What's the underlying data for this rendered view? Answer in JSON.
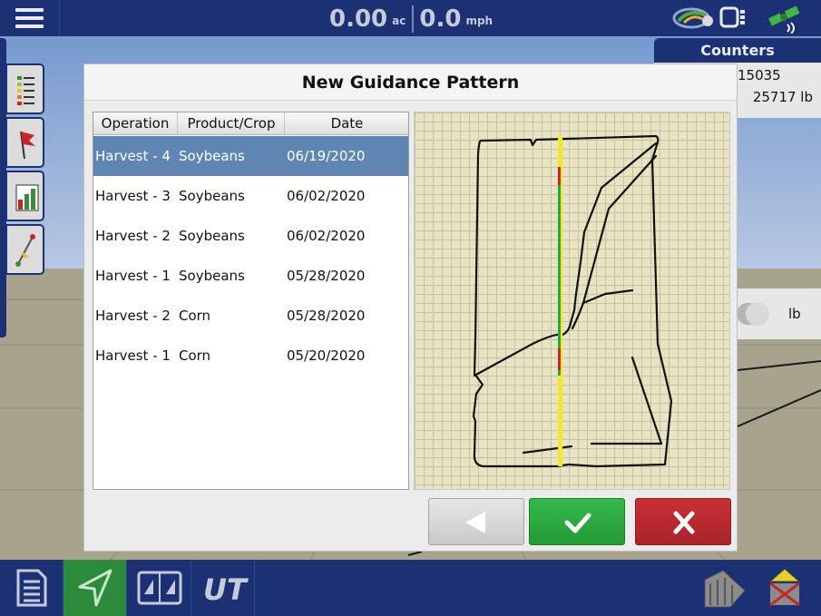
{
  "top_bar": {
    "area_value": "0.00",
    "area_unit": "ac",
    "speed_value": "0.0",
    "speed_unit": "mph",
    "icons": [
      "menu-icon",
      "wireless-cloud-icon",
      "display-device-icon",
      "gps-satellite-icon"
    ]
  },
  "counters": {
    "title": "Counters",
    "value_1": "15035",
    "value_2": "25717 lb",
    "toggle_unit": "lb"
  },
  "left_toolbar": {
    "icons": [
      "legend-icon",
      "flag-icon",
      "bar-chart-icon",
      "guidance-line-icon"
    ]
  },
  "bottom_bar": {
    "icons": [
      "document-icon",
      "navigation-arrow-icon",
      "split-view-icon",
      "ut-icon",
      "bin-icon",
      "warning-icon"
    ],
    "ut_label": "UT"
  },
  "dialog": {
    "title": "New Guidance Pattern",
    "columns": [
      "Operation",
      "Product/Crop",
      "Date"
    ],
    "rows": [
      {
        "operation": "Harvest - 4",
        "crop": "Soybeans",
        "date": "06/19/2020",
        "selected": true
      },
      {
        "operation": "Harvest - 3",
        "crop": "Soybeans",
        "date": "06/02/2020",
        "selected": false
      },
      {
        "operation": "Harvest - 2",
        "crop": "Soybeans",
        "date": "06/02/2020",
        "selected": false
      },
      {
        "operation": "Harvest - 1",
        "crop": "Soybeans",
        "date": "05/28/2020",
        "selected": false
      },
      {
        "operation": "Harvest - 2",
        "crop": "Corn",
        "date": "05/28/2020",
        "selected": false
      },
      {
        "operation": "Harvest - 1",
        "crop": "Corn",
        "date": "05/20/2020",
        "selected": false
      }
    ],
    "buttons": [
      "back-arrow-icon",
      "checkmark-icon",
      "close-x-icon"
    ]
  },
  "colors": {
    "nav_blue": "#1b3173",
    "selection_blue": "#5f86b3",
    "ok_green": "#2aa53d",
    "cancel_red": "#b8292f",
    "grid_yellow": "#e8e3c2"
  }
}
